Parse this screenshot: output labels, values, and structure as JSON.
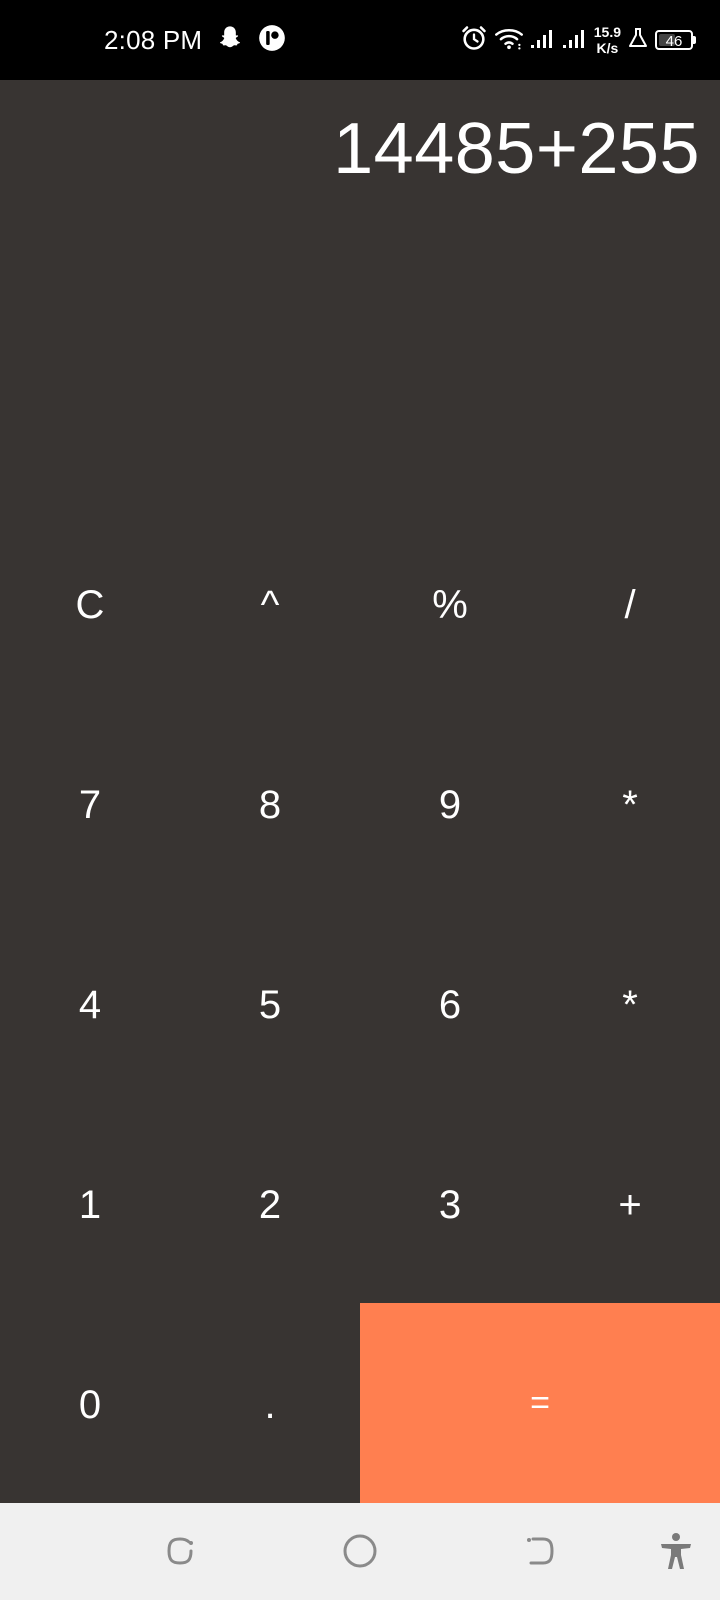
{
  "status_bar": {
    "time": "2:08 PM",
    "net_speed_value": "15.9",
    "net_speed_unit": "K/s",
    "battery": "46",
    "icons": [
      "snapchat-icon",
      "app-notification-icon",
      "alarm-icon",
      "wifi-icon",
      "signal-icon",
      "signal-icon-2",
      "lab-icon",
      "battery-icon"
    ]
  },
  "display": {
    "expression": "14485+255"
  },
  "keys": {
    "clear": "C",
    "power": "^",
    "percent": "%",
    "divide": "/",
    "seven": "7",
    "eight": "8",
    "nine": "9",
    "multiply": "*",
    "four": "4",
    "five": "5",
    "six": "6",
    "multiply_2": "*",
    "one": "1",
    "two": "2",
    "three": "3",
    "plus": "+",
    "zero": "0",
    "dot": ".",
    "equals": "="
  },
  "colors": {
    "background": "#383432",
    "equals_accent": "#ff7f50",
    "status_bar": "#000000",
    "nav_bar": "#f0f0f0"
  },
  "nav_bar": {
    "icons": [
      "recents-icon",
      "home-icon",
      "back-icon",
      "accessibility-icon"
    ]
  }
}
